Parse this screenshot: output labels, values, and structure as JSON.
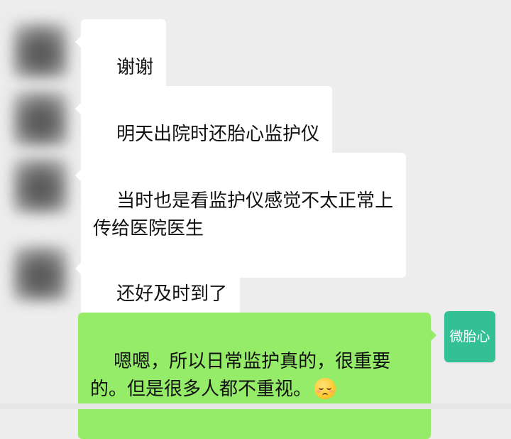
{
  "messages": [
    {
      "side": "left",
      "text": "谢谢"
    },
    {
      "side": "left",
      "text": "明天出院时还胎心监护仪"
    },
    {
      "side": "left",
      "text": "当时也是看监护仪感觉不太正常上\n传给医院医生"
    },
    {
      "side": "left",
      "text": "还好及时到了"
    },
    {
      "side": "right",
      "text": "嗯嗯，所以日常监护真的，很重要\n的。但是很多人都不重视。",
      "emoji": "pensive-face"
    }
  ],
  "self_avatar": {
    "label": "微胎心",
    "color": "#34c095"
  },
  "colors": {
    "background": "#ededed",
    "incoming_bubble": "#ffffff",
    "outgoing_bubble": "#95ec69"
  }
}
